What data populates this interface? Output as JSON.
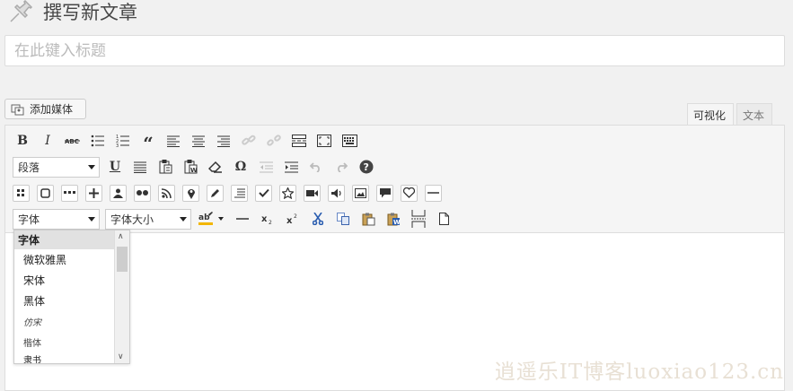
{
  "page": {
    "title": "撰写新文章"
  },
  "title_field": {
    "placeholder": "在此键入标题"
  },
  "media": {
    "add_label": "添加媒体"
  },
  "tabs": {
    "visual": "可视化",
    "text": "文本"
  },
  "toolbar": {
    "format_select": "段落",
    "font_select": "字体",
    "size_select": "字体大小"
  },
  "font_dropdown": {
    "header": "字体",
    "items": [
      "微软雅黑",
      "宋体",
      "黑体",
      "仿宋",
      "楷体",
      "隶书"
    ]
  },
  "watermark": "逍遥乐IT博客luoxiao123.cn"
}
